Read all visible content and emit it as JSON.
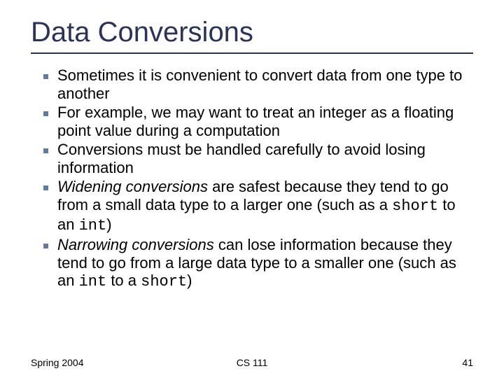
{
  "title": "Data Conversions",
  "bullets": [
    {
      "segments": [
        {
          "t": "Sometimes it is convenient to convert data from one type to another"
        }
      ]
    },
    {
      "segments": [
        {
          "t": "For example, we may want to treat an integer as a floating point value during a computation"
        }
      ]
    },
    {
      "segments": [
        {
          "t": "Conversions must be handled carefully to avoid losing information"
        }
      ]
    },
    {
      "segments": [
        {
          "t": "Widening conversions",
          "em": true
        },
        {
          "t": " are safest because they tend to go from a small data type to a larger one (such as a "
        },
        {
          "t": "short",
          "mono": true
        },
        {
          "t": " to an "
        },
        {
          "t": "int",
          "mono": true
        },
        {
          "t": ")"
        }
      ]
    },
    {
      "segments": [
        {
          "t": "Narrowing conversions",
          "em": true
        },
        {
          "t": " can lose information because they tend to go from a large data type to a smaller one (such as an "
        },
        {
          "t": "int",
          "mono": true
        },
        {
          "t": " to a "
        },
        {
          "t": "short",
          "mono": true
        },
        {
          "t": ")"
        }
      ]
    }
  ],
  "footer": {
    "left": "Spring 2004",
    "center": "CS 111",
    "right": "41"
  }
}
